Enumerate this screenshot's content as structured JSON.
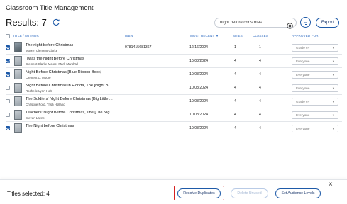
{
  "page": {
    "title": "Classroom Title Management",
    "results_label": "Results: 7"
  },
  "search": {
    "value": "night before christmas",
    "export_label": "Export"
  },
  "table": {
    "columns": [
      "Title / Author",
      "ISBN",
      "Most Recent",
      "Sites",
      "Classes",
      "Approved For"
    ],
    "sort_indicator": "▼",
    "rows": [
      {
        "checked": true,
        "title": "The night before Christmas",
        "author": "Moore, Clement Clarke",
        "isbn": "9781415681367",
        "date": "12/16/2024",
        "sites": "1",
        "classes": "1",
        "approved": "Grade 6+"
      },
      {
        "checked": true,
        "title": "'Twas the Night Before Christmas",
        "author": "Clement Clarke Moore, Mark Marshall",
        "isbn": "",
        "date": "10/03/2024",
        "sites": "4",
        "classes": "4",
        "approved": "Everyone"
      },
      {
        "checked": true,
        "title": "Night Before Christmas [Blue Ribbon Book]",
        "author": "Clement C. Moore",
        "isbn": "",
        "date": "10/03/2024",
        "sites": "4",
        "classes": "4",
        "approved": "Everyone"
      },
      {
        "checked": false,
        "title": "Night Before Christmas in Florida, The [Night B...",
        "author": "Rochelle Lynn Holt",
        "isbn": "",
        "date": "10/03/2024",
        "sites": "4",
        "classes": "4",
        "approved": "Everyone"
      },
      {
        "checked": false,
        "title": "The Soldiers' Night Before Christmas [Big Little ...",
        "author": "Christine Ford, Trish Holland",
        "isbn": "",
        "date": "10/03/2024",
        "sites": "4",
        "classes": "4",
        "approved": "Grade 6+"
      },
      {
        "checked": false,
        "title": "Teachers' Night Before Christmas, The [The Nig...",
        "author": "Steven Layne",
        "isbn": "",
        "date": "10/03/2024",
        "sites": "4",
        "classes": "4",
        "approved": "Everyone"
      },
      {
        "checked": true,
        "title": "The Night before Christmas",
        "author": "",
        "isbn": "",
        "date": "10/03/2024",
        "sites": "4",
        "classes": "4",
        "approved": "Everyone"
      }
    ]
  },
  "bottom_bar": {
    "selected_label": "Titles selected: 4",
    "resolve_label": "Resolve Duplicates",
    "delete_label": "Delete Unused",
    "audience_label": "Set Audience Levels",
    "close_symbol": "×"
  },
  "colors": {
    "accent": "#1e5aa8",
    "highlight": "#d62020"
  },
  "icons": [
    "refresh-icon",
    "clear-search-icon",
    "filter-icon",
    "close-icon",
    "chevron-down-icon"
  ]
}
